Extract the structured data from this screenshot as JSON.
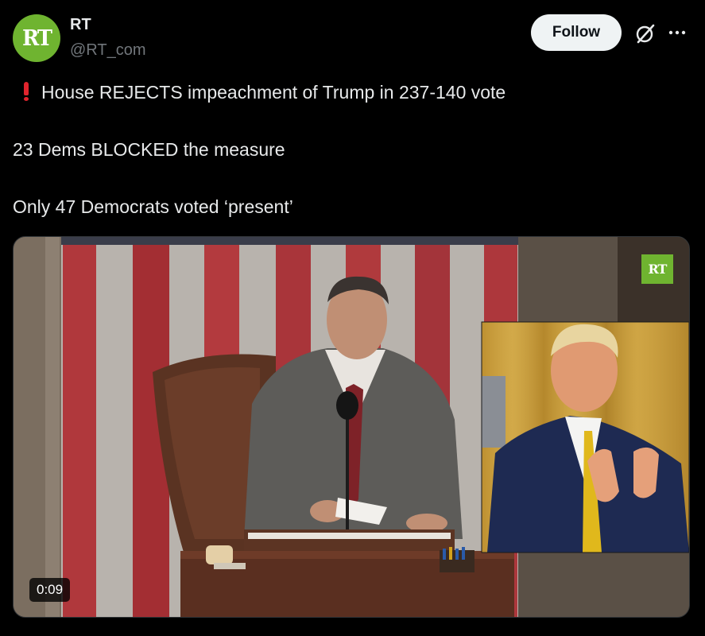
{
  "author": {
    "display_name": "RT",
    "handle": "@RT_com",
    "avatar_text": "RT"
  },
  "actions": {
    "follow_label": "Follow",
    "grok_icon": "grok-icon",
    "more_icon": "more-horizontal-icon"
  },
  "tweet": {
    "line1": "House REJECTS impeachment of Trump in 237-140 vote",
    "line2": "23 Dems BLOCKED the measure",
    "line3": "Only 47 Democrats voted ‘present’"
  },
  "video": {
    "duration": "0:09",
    "watermark": "RT"
  },
  "colors": {
    "accent_green": "#6fb430",
    "alert_red": "#e0242d",
    "follow_bg": "#eff3f4",
    "muted_text": "#71767b"
  }
}
